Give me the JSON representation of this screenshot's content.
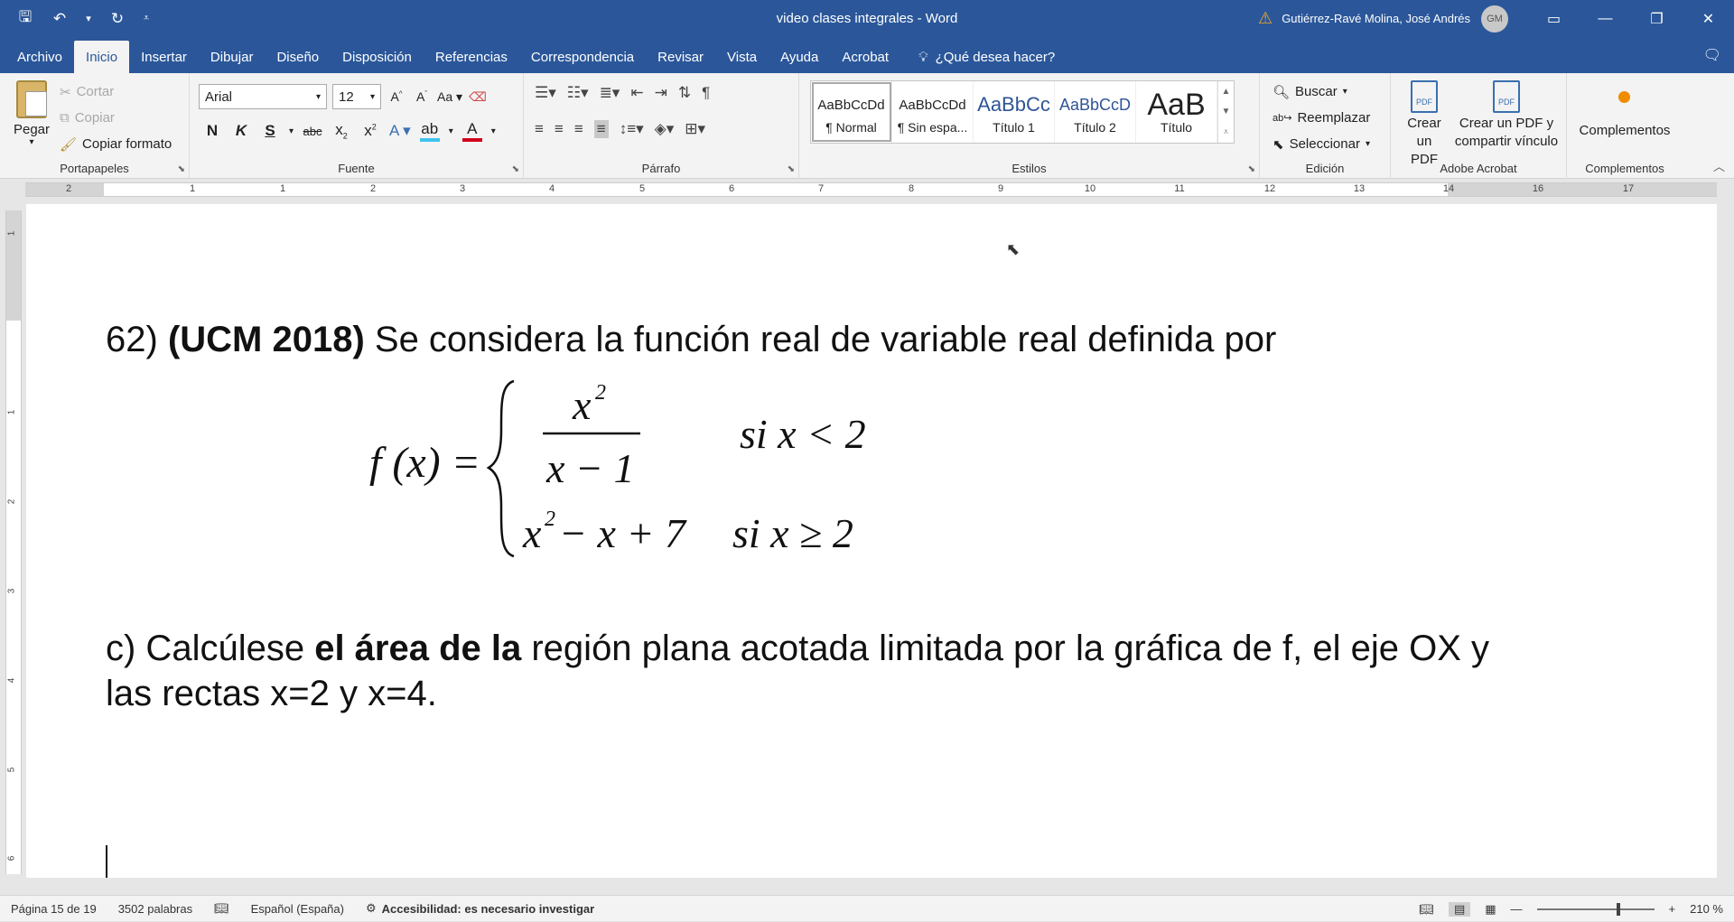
{
  "titlebar": {
    "doc_title": "video clases integrales  -  Word",
    "user_name": "Gutiérrez-Ravé Molina, José Andrés",
    "avatar_initials": "GM"
  },
  "tabs": {
    "items": [
      "Archivo",
      "Inicio",
      "Insertar",
      "Dibujar",
      "Diseño",
      "Disposición",
      "Referencias",
      "Correspondencia",
      "Revisar",
      "Vista",
      "Ayuda",
      "Acrobat"
    ],
    "active": "Inicio",
    "tell_me": "¿Qué desea hacer?"
  },
  "ribbon": {
    "clipboard": {
      "label": "Portapapeles",
      "paste": "Pegar",
      "cut": "Cortar",
      "copy": "Copiar",
      "format_painter": "Copiar formato"
    },
    "font": {
      "label": "Fuente",
      "font_name": "Arial",
      "font_size": "12",
      "case_btn": "Aa",
      "bold": "N",
      "italic": "K",
      "underline": "S",
      "strike": "abc"
    },
    "paragraph": {
      "label": "Párrafo"
    },
    "styles": {
      "label": "Estilos",
      "items": [
        {
          "preview": "AaBbCcDd",
          "name": "¶ Normal"
        },
        {
          "preview": "AaBbCcDd",
          "name": "¶ Sin espa..."
        },
        {
          "preview": "AaBbCc",
          "name": "Título 1"
        },
        {
          "preview": "AaBbCcD",
          "name": "Título 2"
        },
        {
          "preview": "AaB",
          "name": "Título"
        }
      ]
    },
    "editing": {
      "label": "Edición",
      "find": "Buscar",
      "replace": "Reemplazar",
      "select": "Seleccionar"
    },
    "acrobat": {
      "label": "Adobe Acrobat",
      "create_pdf_1": "Crear",
      "create_pdf_2": "un PDF",
      "share_pdf_1": "Crear un PDF y",
      "share_pdf_2": "compartir vínculo"
    },
    "addins": {
      "label": "Complementos",
      "button": "Complementos"
    }
  },
  "document": {
    "question_num": "62)",
    "question_source": "(UCM 2018)",
    "question_text": " Se considera la función real de variable real definida por",
    "formula": {
      "lhs": "f (x) =",
      "numerator": "x",
      "num_exp": "2",
      "denominator": "x − 1",
      "cond1": "si  x < 2",
      "case2": "x",
      "case2_exp": "2",
      "case2_rest": " − x + 7",
      "cond2": "si   x ≥ 2"
    },
    "part_c_1": "c) Calcúlese ",
    "part_c_bold": "el área de la",
    "part_c_2": " región plana acotada limitada por la gráfica de f, el eje OX y las rectas x=2 y x=4."
  },
  "ruler": {
    "numbers": [
      "2",
      "1",
      "1",
      "2",
      "3",
      "4",
      "5",
      "6",
      "7",
      "8",
      "9",
      "10",
      "11",
      "12",
      "13",
      "14",
      "16",
      "17"
    ],
    "vertical_numbers": [
      "1",
      "1",
      "2",
      "3",
      "4",
      "5",
      "6"
    ]
  },
  "status": {
    "page": "Página 15 de 19",
    "words": "3502 palabras",
    "language": "Español (España)",
    "accessibility": "Accesibilidad: es necesario investigar",
    "zoom": "210 %"
  }
}
